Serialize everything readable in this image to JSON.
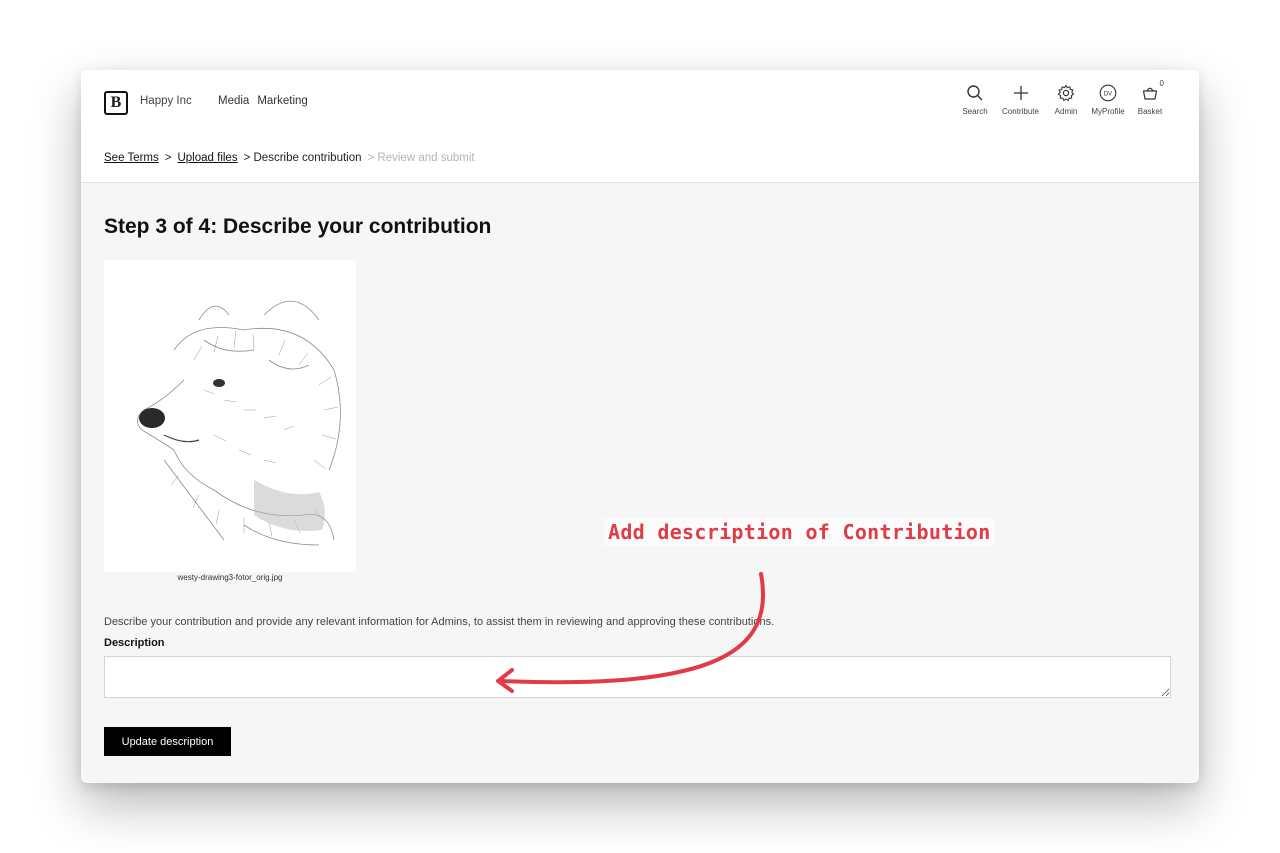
{
  "header": {
    "org_name": "Happy Inc",
    "logo_glyph": "B",
    "nav": [
      "Media",
      "Marketing"
    ],
    "tools": [
      {
        "label": "Search",
        "icon": "search-icon"
      },
      {
        "label": "Contribute",
        "icon": "plus-icon"
      },
      {
        "label": "Admin",
        "icon": "gear-icon"
      },
      {
        "label": "MyProfile",
        "icon": "avatar-icon",
        "initials": "DV"
      },
      {
        "label": "Basket",
        "icon": "basket-icon",
        "count": "0"
      }
    ]
  },
  "breadcrumb": {
    "terms": "See Terms",
    "upload": "Upload files",
    "current": "> Describe contribution",
    "next": "> Review and submit",
    "sep": ">"
  },
  "main": {
    "title": "Step 3 of 4: Describe your contribution",
    "filename": "westy-drawing3-fotor_orig.jpg",
    "help_text": "Describe your contribution and provide any relevant information for Admins, to assist them in reviewing and approving these contributions.",
    "description_label": "Description",
    "description_value": "",
    "button_label": "Update description"
  },
  "annotation": {
    "text": "Add description of Contribution",
    "color": "#e03c48"
  }
}
